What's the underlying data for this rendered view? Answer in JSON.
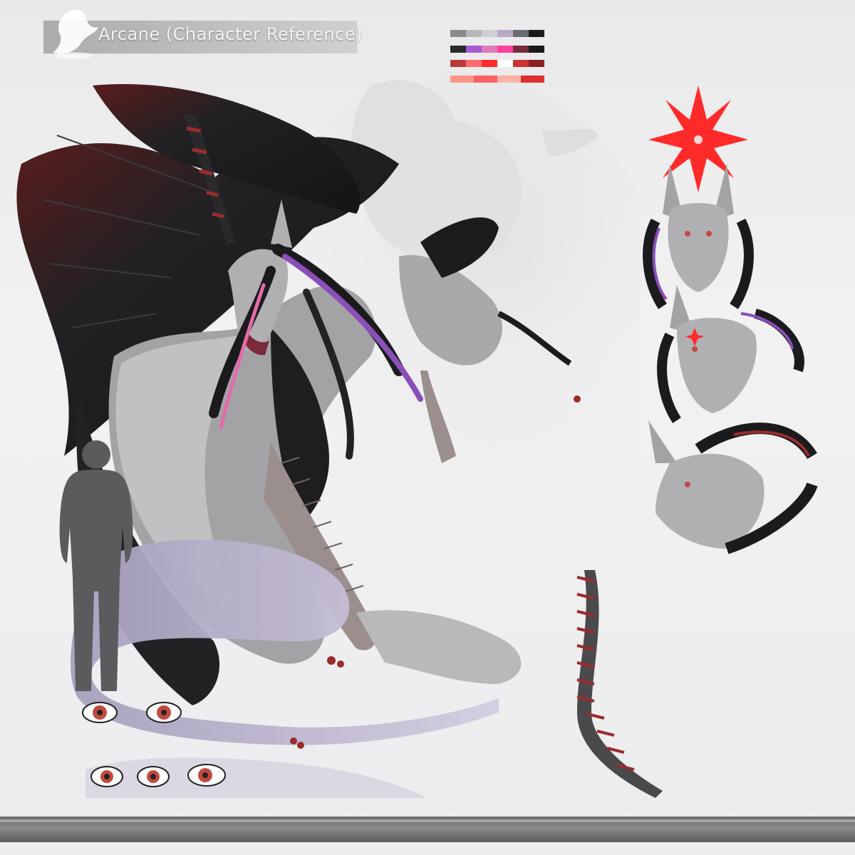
{
  "header": {
    "title": "Arcane (Character Reference)"
  },
  "logo": {
    "icon": "dragon-head-logo-icon"
  },
  "palette": {
    "rows": [
      [
        "#8a8a8e",
        "#b7b7bb",
        "#cfcfd2",
        "#b7a8c6",
        "#6c6a72",
        "#1b1b1d"
      ],
      [
        "#2a2a2d",
        "#a65ad1",
        "#e07ab8",
        "#ff3ea0",
        "#7a2a3a",
        "#1a1a1a"
      ],
      [
        "#b93a3a",
        "#ff6b6b",
        "#ff2a2a",
        "#ffffff",
        "#cc3333",
        "#8b2222"
      ],
      [
        "#ff8c7a",
        "#ff5050",
        "#ffb0a0",
        "#e03030"
      ]
    ]
  },
  "colors": {
    "fur": "#9c9c9f",
    "fur_light": "#c8c8cb",
    "wing": "#1c1b1d",
    "wing_tip": "#5a1c1c",
    "hair_purple": "#8a4fb8",
    "hair_pink": "#e46aa8",
    "stripe_red": "#9b2c2c",
    "tail_purple": "#bbb1cf",
    "star_red": "#ff2a2a",
    "eye_red": "#c24a40"
  }
}
